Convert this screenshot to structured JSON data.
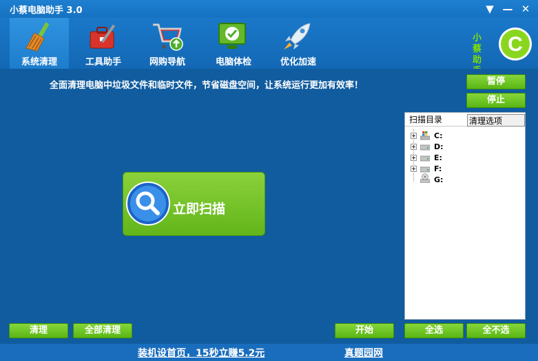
{
  "window": {
    "title": "小蔡电脑助手 3.0",
    "controls": {
      "menu": "▼",
      "minimize": "—",
      "close": "✕"
    }
  },
  "nav": {
    "tabs": [
      {
        "label": "系统清理",
        "icon": "broom-icon",
        "active": true
      },
      {
        "label": "工具助手",
        "icon": "toolbox-icon",
        "active": false
      },
      {
        "label": "网购导航",
        "icon": "shopping-cart-icon",
        "active": false
      },
      {
        "label": "电脑体检",
        "icon": "monitor-check-icon",
        "active": false
      },
      {
        "label": "优化加速",
        "icon": "rocket-icon",
        "active": false
      }
    ]
  },
  "logo": {
    "line1": "小蔡",
    "line2": "助手",
    "letter": "C"
  },
  "main": {
    "description": "全面清理电脑中垃圾文件和临时文件，节省磁盘空间，让系统运行更加有效率！",
    "pause_label": "暂停",
    "stop_label": "停止",
    "scan_label": "立即扫描"
  },
  "panel": {
    "tabs": [
      "扫描目录",
      "清理选项"
    ],
    "drives": [
      "C:",
      "D:",
      "E:",
      "F:",
      "G:"
    ]
  },
  "bottom": {
    "clean_label": "清理",
    "clean_all_label": "全部清理",
    "start_label": "开始",
    "select_all_label": "全选",
    "select_none_label": "全不选"
  },
  "footer": {
    "link1": "装机设首页，15秒立赚5.2元",
    "link2": "真题园网"
  },
  "colors": {
    "accent_green": "#6cc222",
    "background_blue": "#105c9f"
  }
}
